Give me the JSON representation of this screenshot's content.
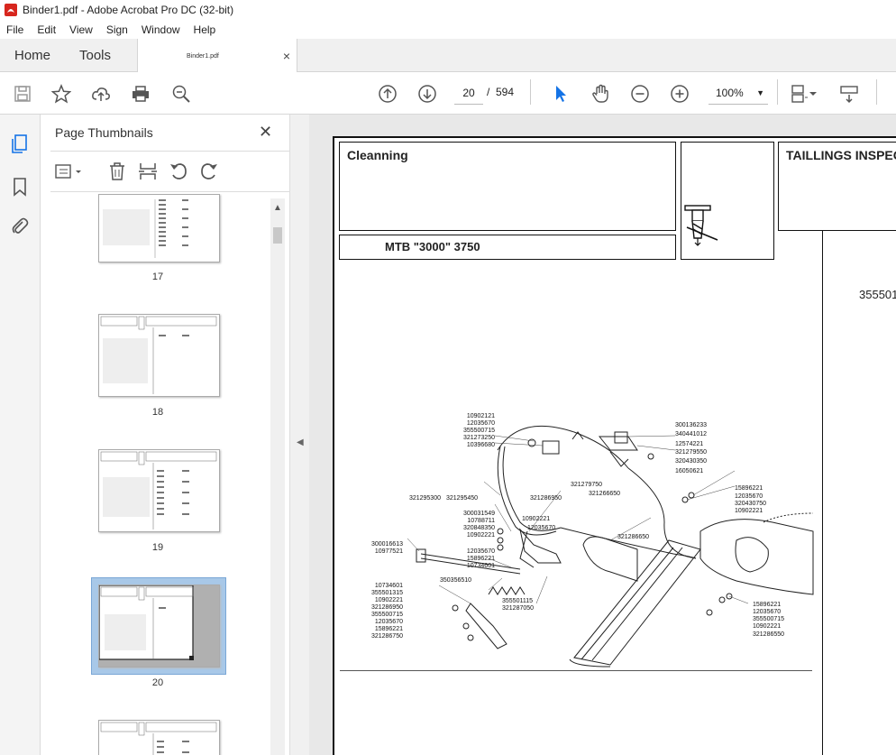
{
  "window": {
    "title": "Binder1.pdf - Adobe Acrobat Pro DC (32-bit)"
  },
  "menu": [
    "File",
    "Edit",
    "View",
    "Sign",
    "Window",
    "Help"
  ],
  "tabs": {
    "home": "Home",
    "tools": "Tools",
    "doc": "Binder1.pdf",
    "close": "×"
  },
  "nav": {
    "current_page": "20",
    "separator": "/",
    "total_pages": "594",
    "zoom": "100%"
  },
  "panel": {
    "title": "Page Thumbnails",
    "close": "✕"
  },
  "thumbnails": [
    {
      "label": "17"
    },
    {
      "label": "18"
    },
    {
      "label": "19"
    },
    {
      "label": "20",
      "selected": true
    },
    {
      "label": ""
    }
  ],
  "document": {
    "section_title": "Cleanning",
    "model": "MTB \"3000\" 3750",
    "right_title": "TAILLINGS INSPECT",
    "right_part": "355501"
  },
  "diagram_labels": {
    "left_top": [
      "10902121",
      "12035670",
      "355500715",
      "321273250",
      "10396680"
    ],
    "right_top": [
      "300136233",
      "340441012",
      "12574221",
      "321279550",
      "320430350",
      "16050621"
    ],
    "mid1": [
      "321279750",
      "321266650"
    ],
    "mid2": [
      "321295300",
      "321295450"
    ],
    "mid3": [
      "321286950"
    ],
    "right_mid": [
      "15896221",
      "12035670",
      "320430750",
      "10902221"
    ],
    "left_mid": [
      "300031549",
      "10788711",
      "320848350",
      "10902221"
    ],
    "center_mid": [
      "10902221",
      "12035670"
    ],
    "center_right": [
      "321286650"
    ],
    "left_low": [
      "300016613",
      "10977521"
    ],
    "left_low2": [
      "12035670",
      "15896221",
      "10734601"
    ],
    "center_low": [
      "350356510"
    ],
    "left_bottom": [
      "10734601",
      "355501315",
      "10902221",
      "321286950",
      "355500715",
      "12035670",
      "15896221",
      "321286750"
    ],
    "center_bottom": [
      "355501115",
      "321287050"
    ],
    "right_bottom": [
      "15896221",
      "12035670",
      "355500715",
      "10902221",
      "321286550"
    ]
  },
  "colors": {
    "accent": "#1473e6",
    "selection": "#a8c8e8"
  }
}
